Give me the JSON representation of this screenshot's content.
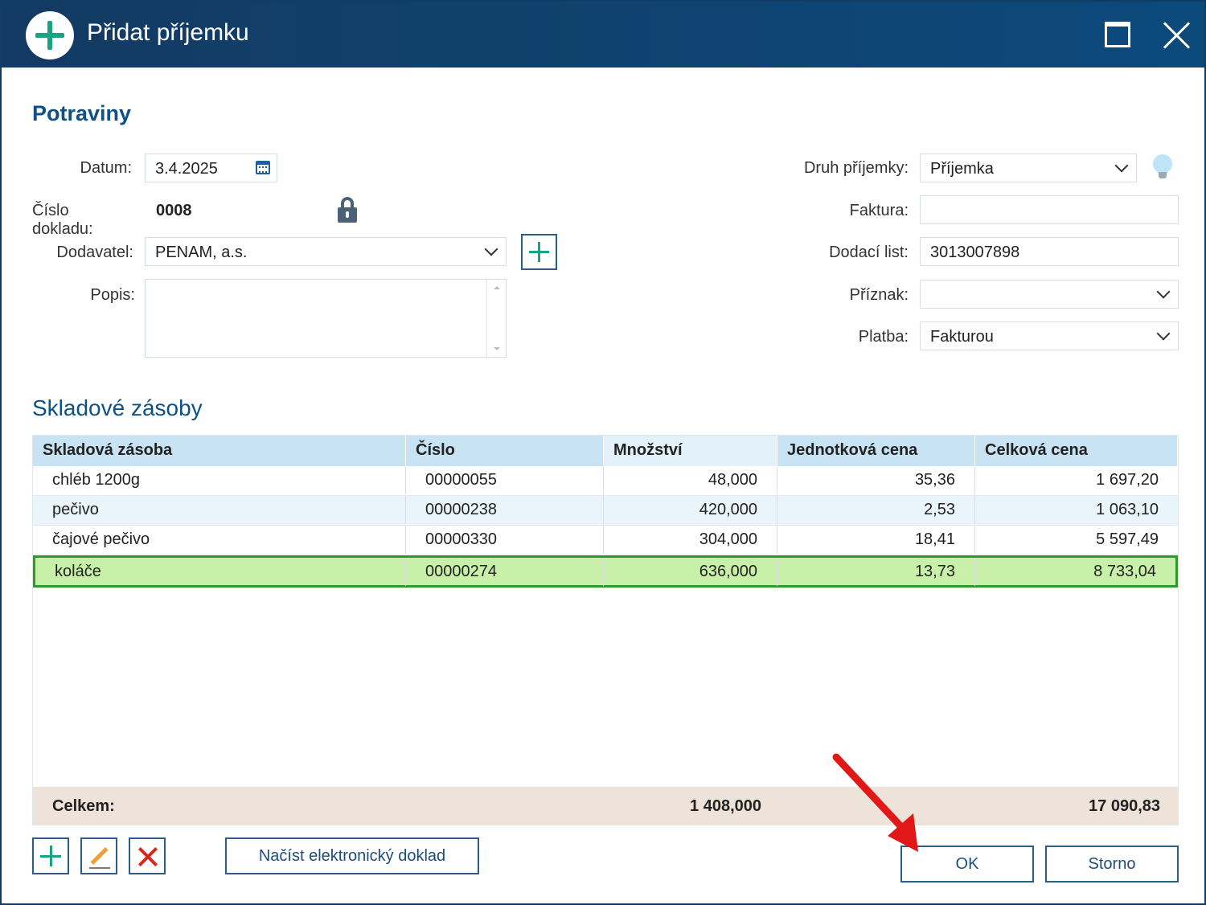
{
  "window": {
    "title": "Přidat příjemku"
  },
  "form": {
    "section_title": "Potraviny",
    "date_label": "Datum:",
    "date_value": "3.4.2025",
    "doc_number_label": "Číslo dokladu:",
    "doc_number_value": "0008",
    "supplier_label": "Dodavatel:",
    "supplier_value": "PENAM, a.s.",
    "description_label": "Popis:",
    "description_value": "",
    "receipt_type_label": "Druh příjemky:",
    "receipt_type_value": "Příjemka",
    "invoice_label": "Faktura:",
    "invoice_value": "",
    "delivery_note_label": "Dodací list:",
    "delivery_note_value": "3013007898",
    "flag_label": "Příznak:",
    "flag_value": "",
    "payment_label": "Platba:",
    "payment_value": "Fakturou"
  },
  "stock": {
    "title": "Skladové zásoby",
    "columns": [
      "Skladová zásoba",
      "Číslo",
      "Množství",
      "Jednotková cena",
      "Celková cena"
    ],
    "rows": [
      {
        "name": "chléb 1200g",
        "number": "00000055",
        "qty": "48,000",
        "unit_price": "35,36",
        "total": "1 697,20"
      },
      {
        "name": "pečivo",
        "number": "00000238",
        "qty": "420,000",
        "unit_price": "2,53",
        "total": "1 063,10"
      },
      {
        "name": "čajové pečivo",
        "number": "00000330",
        "qty": "304,000",
        "unit_price": "18,41",
        "total": "5 597,49"
      },
      {
        "name": "koláče",
        "number": "00000274",
        "qty": "636,000",
        "unit_price": "13,73",
        "total": "8 733,04"
      }
    ],
    "selected_row": 3,
    "footer": {
      "label": "Celkem:",
      "qty_total": "1 408,000",
      "price_total": "17 090,83"
    }
  },
  "buttons": {
    "load_electronic": "Načíst elektronický doklad",
    "ok": "OK",
    "cancel": "Storno"
  },
  "colors": {
    "titlebar": "#0c4a7c",
    "accent": "#0f5185",
    "selected_row": "#c8f0a8",
    "selected_border": "#2f9a2a",
    "annotation_arrow": "#e01818"
  }
}
